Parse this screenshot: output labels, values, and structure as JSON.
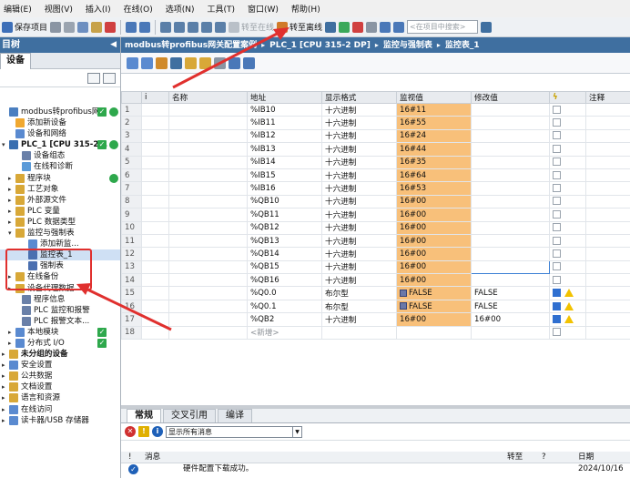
{
  "menu": [
    "编辑(E)",
    "视图(V)",
    "插入(I)",
    "在线(O)",
    "选项(N)",
    "工具(T)",
    "窗口(W)",
    "帮助(H)"
  ],
  "toolbar": {
    "save_label": "保存项目",
    "go_online_label": "转至在线",
    "go_offline_label": "转至离线",
    "search_placeholder": "<在项目中搜索>"
  },
  "left": {
    "title": "目树",
    "tab_label": "设备",
    "tree": [
      {
        "label": "modbus转profibus网...",
        "indent": 0,
        "toggle": "",
        "icon": "#4b7fc0",
        "chk": true,
        "dot": true
      },
      {
        "label": "添加新设备",
        "indent": 1,
        "toggle": "",
        "icon": "#f0a830"
      },
      {
        "label": "设备和网络",
        "indent": 1,
        "toggle": "",
        "icon": "#5a8ad0"
      },
      {
        "label": "PLC_1 [CPU 315-2...",
        "indent": 0,
        "toggle": "▾",
        "icon": "#3a6fb0",
        "chk": true,
        "dot": true,
        "bold": true
      },
      {
        "label": "设备组态",
        "indent": 2,
        "toggle": "",
        "icon": "#6a80a8"
      },
      {
        "label": "在线和诊断",
        "indent": 2,
        "toggle": "",
        "icon": "#5a9ad8"
      },
      {
        "label": "程序块",
        "indent": 1,
        "toggle": "▸",
        "icon": "#d8a838",
        "dot": true
      },
      {
        "label": "工艺对象",
        "indent": 1,
        "toggle": "▸",
        "icon": "#d8a838"
      },
      {
        "label": "外部源文件",
        "indent": 1,
        "toggle": "▸",
        "icon": "#d8a838"
      },
      {
        "label": "PLC 变量",
        "indent": 1,
        "toggle": "▸",
        "icon": "#d8a838"
      },
      {
        "label": "PLC 数据类型",
        "indent": 1,
        "toggle": "▸",
        "icon": "#d8a838"
      },
      {
        "label": "监控与强制表",
        "indent": 1,
        "toggle": "▾",
        "icon": "#d8a838"
      },
      {
        "label": "添加新监...",
        "indent": 3,
        "toggle": "",
        "icon": "#5a8ad0"
      },
      {
        "label": "监控表_1",
        "indent": 3,
        "toggle": "",
        "icon": "#4a6fb0",
        "selected": true
      },
      {
        "label": "强制表",
        "indent": 3,
        "toggle": "",
        "icon": "#4a6fb0"
      },
      {
        "label": "在线备份",
        "indent": 1,
        "toggle": "▸",
        "icon": "#d8a838"
      },
      {
        "label": "设备代理数据",
        "indent": 1,
        "toggle": "▸",
        "icon": "#d8a838"
      },
      {
        "label": "程序信息",
        "indent": 2,
        "toggle": "",
        "icon": "#6a80a8"
      },
      {
        "label": "PLC 监控和报警",
        "indent": 2,
        "toggle": "",
        "icon": "#6a80a8"
      },
      {
        "label": "PLC 报警文本...",
        "indent": 2,
        "toggle": "",
        "icon": "#6a80a8"
      },
      {
        "label": "本地模块",
        "indent": 1,
        "toggle": "▸",
        "icon": "#5a8ad0",
        "chk": true
      },
      {
        "label": "分布式 I/O",
        "indent": 1,
        "toggle": "▸",
        "icon": "#5a8ad0",
        "chk": true
      },
      {
        "label": "未分组的设备",
        "indent": 0,
        "toggle": "▸",
        "icon": "#d8a838",
        "bold": true
      },
      {
        "label": "安全设置",
        "indent": 0,
        "toggle": "▸",
        "icon": "#5a8ad0"
      },
      {
        "label": "公共数据",
        "indent": 0,
        "toggle": "▸",
        "icon": "#d8a838"
      },
      {
        "label": "文档设置",
        "indent": 0,
        "toggle": "▸",
        "icon": "#d8a838"
      },
      {
        "label": "语言和资源",
        "indent": 0,
        "toggle": "▸",
        "icon": "#d8a838"
      },
      {
        "label": "在线访问",
        "indent": 0,
        "toggle": "▸",
        "icon": "#5a8ad0"
      },
      {
        "label": "读卡器/USB 存储器",
        "indent": 0,
        "toggle": "▸",
        "icon": "#5a8ad0"
      }
    ]
  },
  "breadcrumb": [
    "modbus转profibus网关配置案例",
    "PLC_1 [CPU 315-2 DP]",
    "监控与强制表",
    "监控表_1"
  ],
  "table": {
    "headers": [
      "i",
      "名称",
      "地址",
      "显示格式",
      "监视值",
      "修改值",
      "",
      "注释"
    ],
    "rows": [
      {
        "n": "1",
        "addr": "%IB10",
        "fmt": "十六进制",
        "mon": "16#11",
        "mod": "",
        "cb": false
      },
      {
        "n": "2",
        "addr": "%IB11",
        "fmt": "十六进制",
        "mon": "16#55",
        "mod": "",
        "cb": false
      },
      {
        "n": "3",
        "addr": "%IB12",
        "fmt": "十六进制",
        "mon": "16#24",
        "mod": "",
        "cb": false
      },
      {
        "n": "4",
        "addr": "%IB13",
        "fmt": "十六进制",
        "mon": "16#44",
        "mod": "",
        "cb": false
      },
      {
        "n": "5",
        "addr": "%IB14",
        "fmt": "十六进制",
        "mon": "16#35",
        "mod": "",
        "cb": false
      },
      {
        "n": "6",
        "addr": "%IB15",
        "fmt": "十六进制",
        "mon": "16#64",
        "mod": "",
        "cb": false
      },
      {
        "n": "7",
        "addr": "%IB16",
        "fmt": "十六进制",
        "mon": "16#53",
        "mod": "",
        "cb": false
      },
      {
        "n": "8",
        "addr": "%QB10",
        "fmt": "十六进制",
        "mon": "16#00",
        "mod": "",
        "cb": false
      },
      {
        "n": "9",
        "addr": "%QB11",
        "fmt": "十六进制",
        "mon": "16#00",
        "mod": "",
        "cb": false
      },
      {
        "n": "10",
        "addr": "%QB12",
        "fmt": "十六进制",
        "mon": "16#00",
        "mod": "",
        "cb": false
      },
      {
        "n": "11",
        "addr": "%QB13",
        "fmt": "十六进制",
        "mon": "16#00",
        "mod": "",
        "cb": false
      },
      {
        "n": "12",
        "addr": "%QB14",
        "fmt": "十六进制",
        "mon": "16#00",
        "mod": "",
        "cb": false
      },
      {
        "n": "13",
        "addr": "%QB15",
        "fmt": "十六进制",
        "mon": "16#00",
        "mod": "",
        "cb": false,
        "edit": true
      },
      {
        "n": "14",
        "addr": "%QB16",
        "fmt": "十六进制",
        "mon": "16#00",
        "mod": "",
        "cb": false
      },
      {
        "n": "15",
        "addr": "%Q0.0",
        "fmt": "布尔型",
        "mon": "FALSE",
        "mod": "FALSE",
        "cb": true,
        "bool": true
      },
      {
        "n": "16",
        "addr": "%Q0.1",
        "fmt": "布尔型",
        "mon": "FALSE",
        "mod": "FALSE",
        "cb": true,
        "bool": true
      },
      {
        "n": "17",
        "addr": "%QB2",
        "fmt": "十六进制",
        "mon": "16#00",
        "mod": "16#00",
        "cb": true
      },
      {
        "n": "18",
        "addr": "<新增>",
        "fmt": "",
        "mon": "",
        "mod": "",
        "cb": false,
        "newrow": true
      }
    ]
  },
  "inspector": {
    "tabs": [
      "常规",
      "交叉引用",
      "编译"
    ],
    "filter": "显示所有消息",
    "cols": [
      "!",
      "消息",
      "转至",
      "?",
      "日期"
    ],
    "message": "硬件配置下载成功。",
    "date": "2024/10/16"
  }
}
